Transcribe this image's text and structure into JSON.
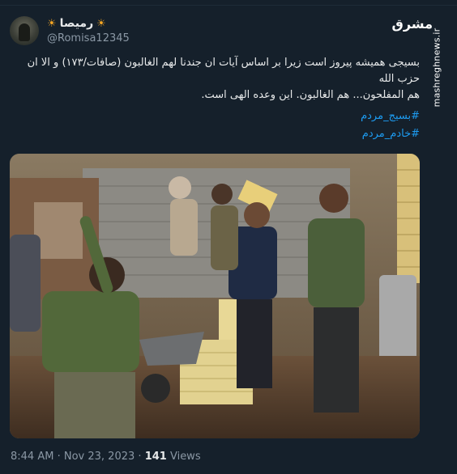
{
  "tweet": {
    "display_name": "رمیصا",
    "name_emoji_left": "☀",
    "name_emoji_right": "☀",
    "handle": "@Romisa12345",
    "text_line1": "بسیجی همیشه پیروز است زیرا بر اساس آیات ان جندنا لهم الغالبون (صافات/۱۷۳) و الا ان حزب الله",
    "text_line2": "هم المفلحون... هم الغالبون. این وعده الهی است.",
    "hashtags": [
      "#بسیج_مردم",
      "#خادم_مردم"
    ],
    "time": "8:44 AM",
    "separator": "·",
    "date": "Nov 23, 2023",
    "views_count": "141",
    "views_label": "Views"
  },
  "watermark": {
    "site": "mashreghnews.ir",
    "logo": "مشرق"
  },
  "colors": {
    "background": "#15202b",
    "text": "#e7e9ea",
    "muted": "#8b98a5",
    "link": "#1d9bf0"
  }
}
